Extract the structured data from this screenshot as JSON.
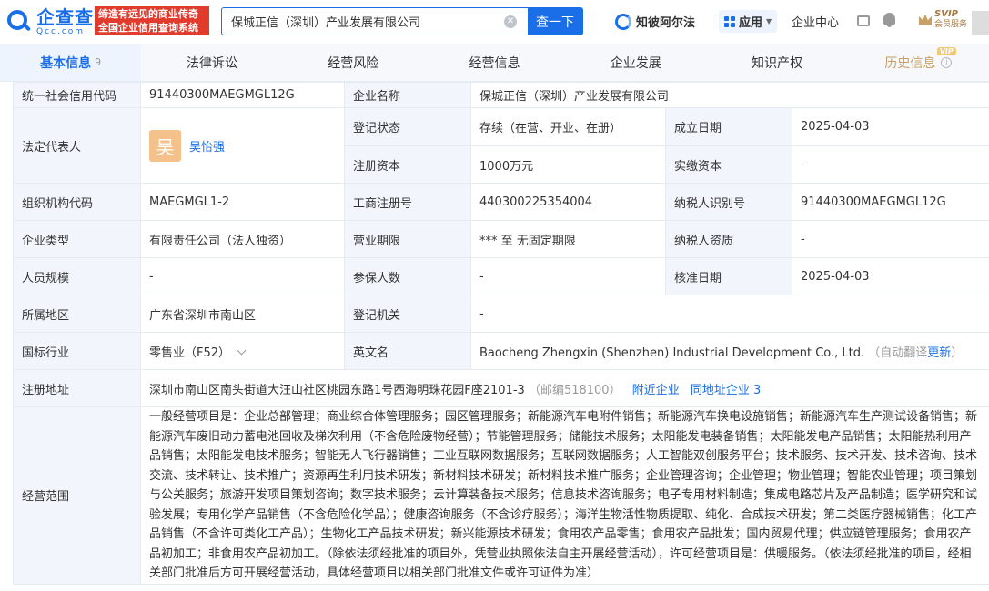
{
  "header": {
    "logo_cn": "企查查",
    "logo_en": "Qcc.com",
    "slogan_line1": "缔造有远见的商业传奇",
    "slogan_line2": "全国企业信用查询系统",
    "search_value": "保城正信（深圳）产业发展有限公司",
    "search_button": "查一下",
    "zhibo": "知彼阿尔法",
    "app": "应用",
    "center": "企业中心",
    "svip": "SVIP",
    "svip_sub": "会员服务"
  },
  "tabs": [
    {
      "label": "基本信息",
      "count": "9"
    },
    {
      "label": "法律诉讼"
    },
    {
      "label": "经营风险"
    },
    {
      "label": "经营信息"
    },
    {
      "label": "企业发展"
    },
    {
      "label": "知识产权"
    },
    {
      "label": "历史信息",
      "badge": "VIP"
    }
  ],
  "info": {
    "credit_code_label": "统一社会信用代码",
    "credit_code": "91440300MAEGMGL12G",
    "company_name_label": "企业名称",
    "company_name": "保城正信（深圳）产业发展有限公司",
    "legal_rep_label": "法定代表人",
    "legal_rep_avatar": "吴",
    "legal_rep": "吴怡强",
    "reg_status_label": "登记状态",
    "reg_status": "存续（在营、开业、在册）",
    "est_date_label": "成立日期",
    "est_date": "2025-04-03",
    "reg_capital_label": "注册资本",
    "reg_capital": "1000万元",
    "paid_capital_label": "实缴资本",
    "paid_capital": "-",
    "org_code_label": "组织机构代码",
    "org_code": "MAEGMGL1-2",
    "biz_reg_no_label": "工商注册号",
    "biz_reg_no": "440300225354004",
    "taxpayer_id_label": "纳税人识别号",
    "taxpayer_id": "91440300MAEGMGL12G",
    "company_type_label": "企业类型",
    "company_type": "有限责任公司（法人独资）",
    "biz_term_label": "营业期限",
    "biz_term": "*** 至 无固定期限",
    "taxpayer_qual_label": "纳税人资质",
    "taxpayer_qual": "-",
    "staff_size_label": "人员规模",
    "staff_size": "-",
    "insured_label": "参保人数",
    "insured": "-",
    "approval_date_label": "核准日期",
    "approval_date": "2025-04-03",
    "region_label": "所属地区",
    "region": "广东省深圳市南山区",
    "reg_authority_label": "登记机关",
    "reg_authority": "-",
    "industry_label": "国标行业",
    "industry": "零售业（F52）",
    "english_name_label": "英文名",
    "english_name": "Baocheng Zhengxin (Shenzhen) Industrial Development Co., Ltd.",
    "auto_translate": "（自动翻译",
    "update_link": "更新",
    "auto_translate_end": "）",
    "address_label": "注册地址",
    "address": "深圳市南山区南头街道大汪山社区桃园东路1号西海明珠花园F座2101-3",
    "postcode": "（邮编518100）",
    "nearby_link": "附近企业",
    "same_address_link": "同地址企业 3",
    "scope_label": "经营范围",
    "scope": "一般经营项目是：企业总部管理；商业综合体管理服务；园区管理服务；新能源汽车电附件销售；新能源汽车换电设施销售；新能源汽车生产测试设备销售；新能源汽车废旧动力蓄电池回收及梯次利用（不含危险废物经营）；节能管理服务；储能技术服务；太阳能发电装备销售；太阳能发电产品销售；太阳能热利用产品销售；太阳能发电技术服务；智能无人飞行器销售；工业互联网数据服务；互联网数据服务；人工智能双创服务平台；技术服务、技术开发、技术咨询、技术交流、技术转让、技术推广；资源再生利用技术研发；新材料技术研发；新材料技术推广服务；企业管理咨询；企业管理；物业管理；智能农业管理；项目策划与公关服务；旅游开发项目策划咨询；数字技术服务；云计算装备技术服务；信息技术咨询服务；电子专用材料制造；集成电路芯片及产品制造；医学研究和试验发展；专用化学产品销售（不含危险化学品）；健康咨询服务（不含诊疗服务）；海洋生物活性物质提取、纯化、合成技术研发；第二类医疗器械销售；化工产品销售（不含许可类化工产品）；生物化工产品技术研发；新兴能源技术研发；食用农产品零售；食用农产品批发；国内贸易代理；供应链管理服务；食用农产品初加工；非食用农产品初加工。（除依法须经批准的项目外，凭营业执照依法自主开展经营活动），许可经营项目是：供暖服务。（依法须经批准的项目，经相关部门批准后方可开展经营活动，具体经营项目以相关部门批准文件或许可证件为准）"
  }
}
